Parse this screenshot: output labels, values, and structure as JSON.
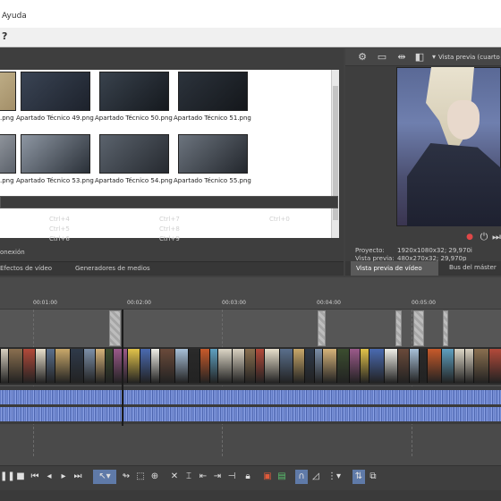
{
  "window": {
    "title_partial": "Ayuda",
    "help_icon": "?"
  },
  "explorer": {
    "thumbnails": [
      {
        "label": ".png",
        "color": "#c9b98f"
      },
      {
        "label": "Apartado Técnico 49.png",
        "color": "#2c3340"
      },
      {
        "label": "Apartado Técnico 50.png",
        "color": "#252b33"
      },
      {
        "label": "Apartado Técnico 51.png",
        "color": "#20252b"
      },
      {
        "label": ".png",
        "color": "#9aa0aa"
      },
      {
        "label": "Apartado Técnico 53.png",
        "color": "#5a6370"
      },
      {
        "label": "Apartado Técnico 54.png",
        "color": "#3a3f47"
      },
      {
        "label": "Apartado Técnico 55.png",
        "color": "#3f454c"
      }
    ],
    "shortcuts": [
      "Ctrl+4",
      "Ctrl+7",
      "Ctrl+0",
      "Ctrl+5",
      "Ctrl+8",
      "Ctrl+6",
      "Ctrl+9"
    ],
    "connection_text": "onexión",
    "tabs": [
      "Efectos de vídeo",
      "Generadores de medios"
    ]
  },
  "preview": {
    "mode_label": "Vista previa (cuarto",
    "project_label": "Proyecto:",
    "project_value": "1920x1080x32; 29,970i",
    "preview_label": "Vista previa:",
    "preview_value": "480x270x32; 29,970p",
    "tab_active": "Vista previa de vídeo",
    "tab_other": "Bus del máster"
  },
  "timeline": {
    "time_labels": [
      "00:01:00",
      "00:02:00",
      "00:03:00",
      "00:04:00",
      "00:05:00"
    ]
  }
}
